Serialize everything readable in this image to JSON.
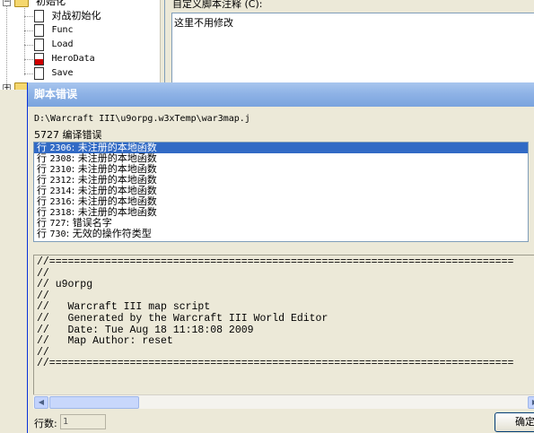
{
  "tree": {
    "root_label": "初始化",
    "items": [
      {
        "label": "对战初始化"
      },
      {
        "label": "Func"
      },
      {
        "label": "Load"
      },
      {
        "label": "HeroData"
      },
      {
        "label": "Save"
      }
    ]
  },
  "comment": {
    "label": "自定义脚本注释 (C):",
    "text": "这里不用修改"
  },
  "dialog": {
    "title": "脚本错误",
    "path": "D:\\Warcraft III\\u9orpg.w3xTemp\\war3map.j",
    "error_count": "5727 编译错误",
    "errors": [
      {
        "line": "2306",
        "text": "未注册的本地函数"
      },
      {
        "line": "2308",
        "text": "未注册的本地函数"
      },
      {
        "line": "2310",
        "text": "未注册的本地函数"
      },
      {
        "line": "2312",
        "text": "未注册的本地函数"
      },
      {
        "line": "2314",
        "text": "未注册的本地函数"
      },
      {
        "line": "2316",
        "text": "未注册的本地函数"
      },
      {
        "line": "2318",
        "text": "未注册的本地函数"
      },
      {
        "line": "727",
        "text": "错误名字"
      },
      {
        "line": "730",
        "text": "无效的操作符类型"
      }
    ],
    "row_prefix": "行",
    "code": "//===========================================================================\n//\n// u9orpg\n//\n//   Warcraft III map script\n//   Generated by the Warcraft III World Editor\n//   Date: Tue Aug 18 11:18:08 2009\n//   Map Author: reset\n//\n//===========================================================================",
    "lines_label": "行数:",
    "lines_value": "1",
    "ok_label": "确定"
  }
}
